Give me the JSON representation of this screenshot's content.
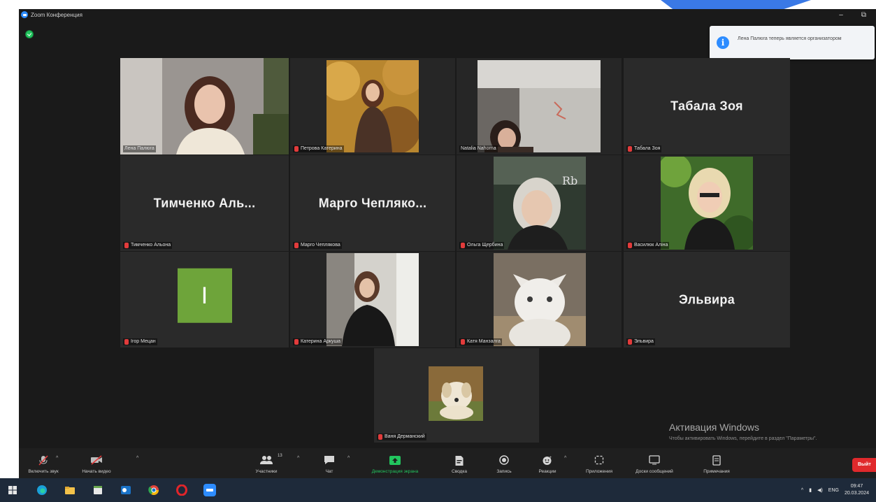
{
  "window": {
    "title": "Zoom Конференция",
    "controls": {
      "minimize": "–",
      "maximize": "⧉"
    }
  },
  "toast": {
    "icon": "info-icon",
    "text": "Лена Палюга теперь является организатором"
  },
  "participants": [
    {
      "label": "Лена Палюга",
      "mic": "unmuted",
      "type": "video",
      "active": true
    },
    {
      "label": "Петрова Катерина",
      "mic": "muted",
      "type": "video"
    },
    {
      "label": "Natalia Nahorna",
      "mic": "unmuted",
      "type": "video"
    },
    {
      "label": "Табала Зоя",
      "mic": "muted",
      "type": "name",
      "display_name": "Табала Зоя"
    },
    {
      "label": "Тимченко Альона",
      "mic": "muted",
      "type": "name",
      "display_name": "Тимченко Аль..."
    },
    {
      "label": "Марго Чеплякова",
      "mic": "muted",
      "type": "name",
      "display_name": "Марго Чепляко..."
    },
    {
      "label": "Ольга Щербина",
      "mic": "muted",
      "type": "video"
    },
    {
      "label": "Василюк Аліна",
      "mic": "muted",
      "type": "video"
    },
    {
      "label": "Ігор Мецан",
      "mic": "muted",
      "type": "avatar",
      "avatar_letter": "I",
      "avatar_color": "#6ea43a"
    },
    {
      "label": "Катерина Аркуша",
      "mic": "muted",
      "type": "video"
    },
    {
      "label": "Катя Манзалга",
      "mic": "muted",
      "type": "video"
    },
    {
      "label": "Эльвира",
      "mic": "muted",
      "type": "name",
      "display_name": "Эльвира"
    },
    {
      "label": "Ваня Дерманский",
      "mic": "muted",
      "type": "video"
    }
  ],
  "toolbar": {
    "unmute": "Включить звук",
    "start_video": "Начать видео",
    "participants": "Участники",
    "participants_count": "13",
    "chat": "Чат",
    "share_screen": "Демонстрация экрана",
    "summary": "Сводка",
    "record": "Запись",
    "reactions": "Реакции",
    "apps": "Приложения",
    "whiteboards": "Доски сообщений",
    "notes": "Примечания",
    "end": "Выйт"
  },
  "watermark": {
    "title": "Активация Windows",
    "text": "Чтобы активировать Windows, перейдите в раздел \"Параметры\"."
  },
  "taskbar": {
    "language": "ENG",
    "time": "09:47",
    "date": "20.03.2024"
  },
  "colors": {
    "accent": "#2d8cff",
    "active_speaker": "#c4e15a",
    "share_green": "#22c55e",
    "end_red": "#e0292c"
  }
}
